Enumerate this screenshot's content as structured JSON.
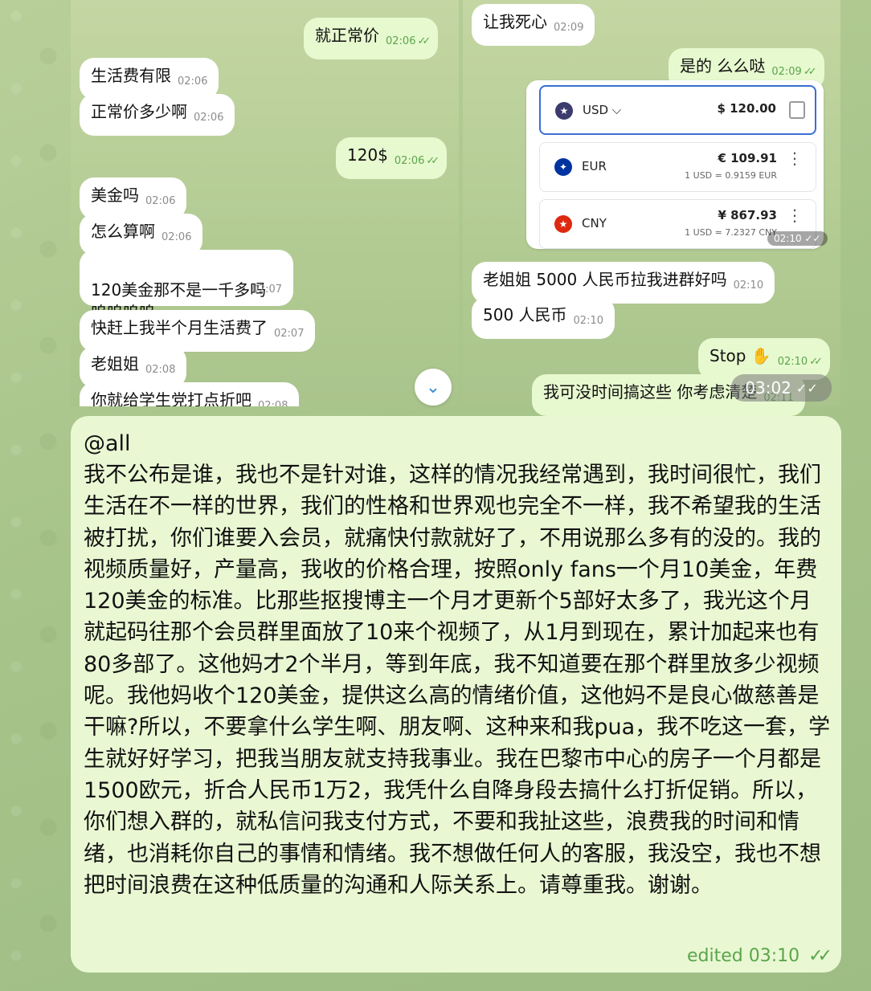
{
  "left_chat": {
    "messages": [
      {
        "text": "就正常价",
        "time": "02:06",
        "out": true
      },
      {
        "text": "生活费有限",
        "time": "02:06",
        "out": false
      },
      {
        "text": "正常价多少啊",
        "time": "02:06",
        "out": false
      },
      {
        "text": "120$",
        "time": "02:06",
        "out": true
      },
      {
        "text": "美金吗",
        "time": "02:06",
        "out": false
      },
      {
        "text": "怎么算啊",
        "time": "02:06",
        "out": false
      },
      {
        "text": "120美金那不是一千多吗\n呜呜呜呜",
        "time": "02:07",
        "out": false
      },
      {
        "text": "快赶上我半个月生活费了",
        "time": "02:07",
        "out": false
      },
      {
        "text": "老姐姐",
        "time": "02:08",
        "out": false
      },
      {
        "text": "你就给学生党打点折吧",
        "time": "02:08",
        "out": false
      }
    ]
  },
  "right_chat": {
    "messages": [
      {
        "text": "让我死心",
        "time": "02:09",
        "out": false
      },
      {
        "text": "是的 么么哒",
        "time": "02:09",
        "out": true
      },
      {
        "text": "老姐姐 5000 人民币拉我进群好吗",
        "time": "02:10",
        "out": false
      },
      {
        "text": "500 人民币",
        "time": "02:10",
        "out": false
      },
      {
        "text": "Stop ✋",
        "time": "02:10",
        "out": true
      },
      {
        "text": "我可没时间搞这些 你考虑清楚",
        "time": "02:11",
        "out": true
      }
    ],
    "converter": {
      "rows": [
        {
          "code": "USD ⌵",
          "amount": "$ 120.00",
          "rate": "",
          "flag_color": "#3c3b6e"
        },
        {
          "code": "EUR",
          "amount": "€ 109.91",
          "rate": "1 USD = 0.9159 EUR",
          "flag_color": "#0033a0"
        },
        {
          "code": "CNY",
          "amount": "¥ 867.93",
          "rate": "1 USD = 7.2327 CNY",
          "flag_color": "#de2910"
        }
      ],
      "image_time": "02:10"
    },
    "media_duration": "03:02"
  },
  "main_message": {
    "mention": "@all",
    "body": "我不公布是谁，我也不是针对谁，这样的情况我经常遇到，我时间很忙，我们生活在不一样的世界，我们的性格和世界观也完全不一样，我不希望我的生活被打扰，你们谁要入会员，就痛快付款就好了，不用说那么多有的没的。我的视频质量好，产量高，我收的价格合理，按照only fans一个月10美金，年费120美金的标准。比那些抠搜博主一个月才更新个5部好太多了，我光这个月就起码往那个会员群里面放了10来个视频了，从1月到现在，累计加起来也有80多部了。这他妈才2个半月，等到年底，我不知道要在那个群里放多少视频呢。我他妈收个120美金，提供这么高的情绪价值，这他妈不是良心做慈善是干嘛?所以，不要拿什么学生啊、朋友啊、这种来和我pua，我不吃这一套，学生就好好学习，把我当朋友就支持我事业。我在巴黎市中心的房子一个月都是1500欧元，折合人民币1万2，我凭什么自降身段去搞什么打折促销。所以，你们想入群的，就私信问我支付方式，不要和我扯这些，浪费我的时间和情绪，也消耗你自己的事情和情绪。我不想做任何人的客服，我没空，我也不想把时间浪费在这种低质量的沟通和人际关系上。请尊重我。谢谢。",
    "edited": "edited 03:10"
  },
  "icons": {
    "scroll_down": "chevron-down-icon",
    "read": "double-check-icon"
  }
}
